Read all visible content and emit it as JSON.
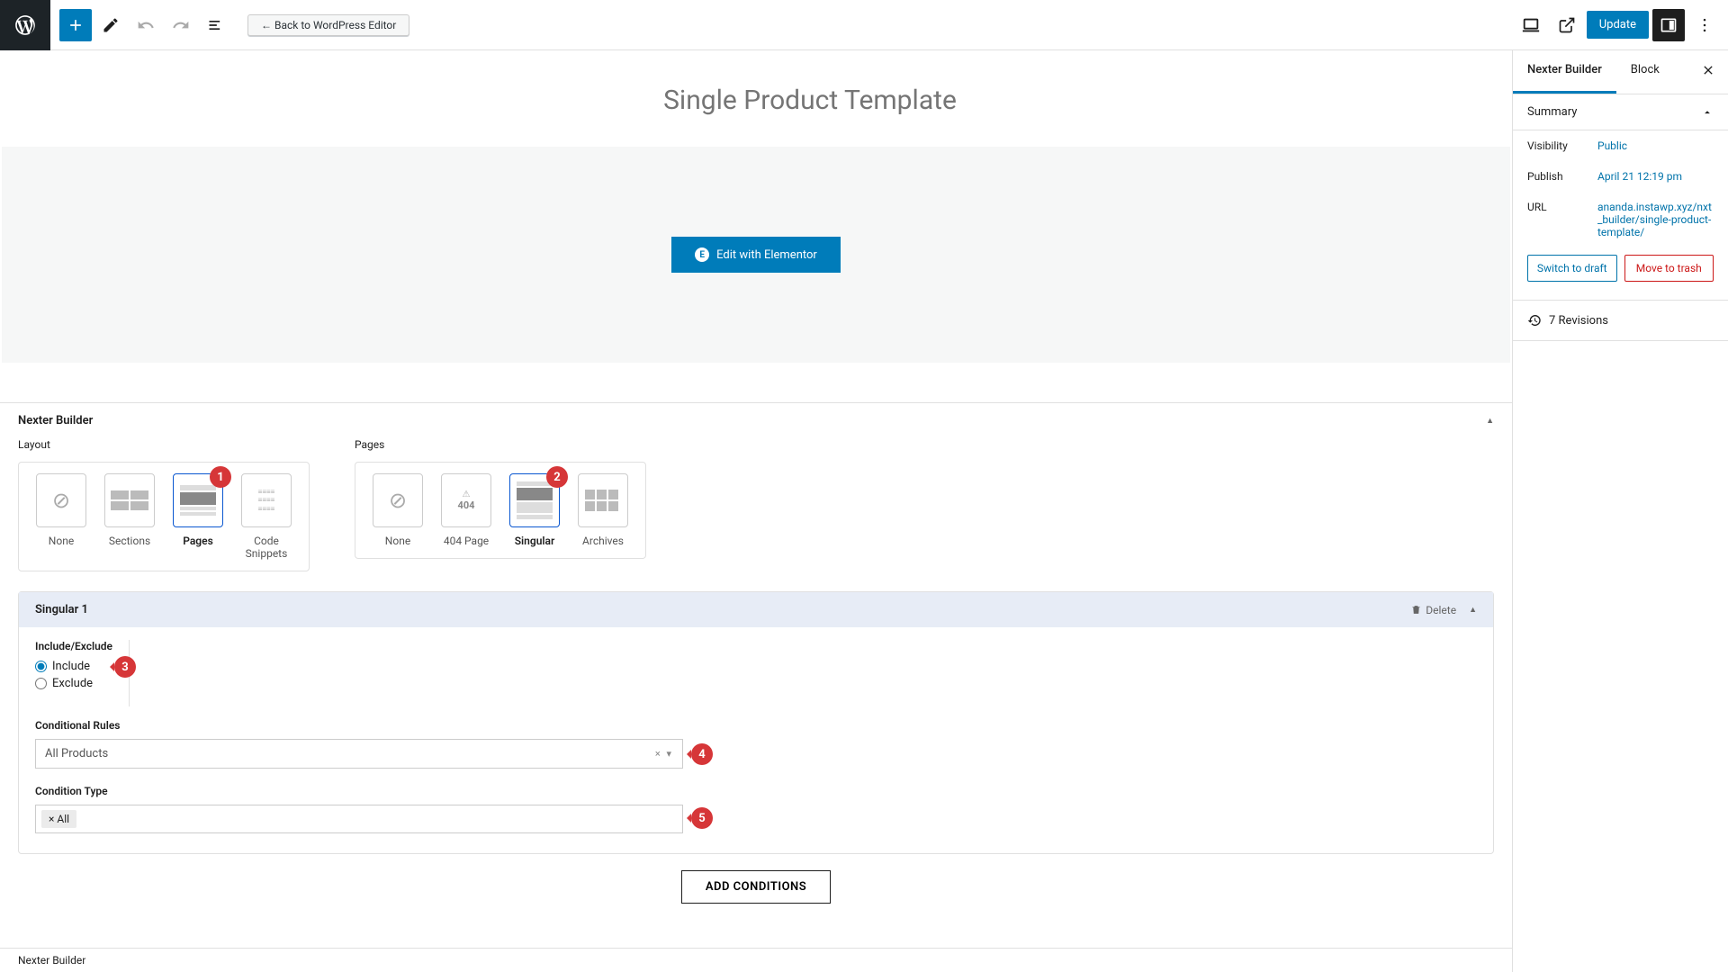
{
  "toolbar": {
    "back_label": "← Back to WordPress Editor",
    "update_label": "Update"
  },
  "page": {
    "title": "Single Product Template",
    "elementor_btn": "Edit with Elementor"
  },
  "nexter": {
    "header": "Nexter Builder",
    "layout_label": "Layout",
    "pages_label": "Pages",
    "layout_cards": [
      {
        "label": "None"
      },
      {
        "label": "Sections"
      },
      {
        "label": "Pages"
      },
      {
        "label": "Code Snippets"
      }
    ],
    "pages_cards": [
      {
        "label": "None"
      },
      {
        "label": "404 Page"
      },
      {
        "label": "Singular"
      },
      {
        "label": "Archives"
      }
    ],
    "singular": {
      "title": "Singular 1",
      "delete": "Delete",
      "ie_label": "Include/Exclude",
      "include": "Include",
      "exclude": "Exclude",
      "cond_rules": "Conditional Rules",
      "cond_value": "All Products",
      "cond_type": "Condition Type",
      "type_value": "× All",
      "add_btn": "ADD CONDITIONS"
    },
    "footer": "Nexter Builder"
  },
  "sidebar": {
    "tab1": "Nexter Builder",
    "tab2": "Block",
    "summary": "Summary",
    "visibility_k": "Visibility",
    "visibility_v": "Public",
    "publish_k": "Publish",
    "publish_v": "April 21 12:19 pm",
    "url_k": "URL",
    "url_v": "ananda.instawp.xyz/nxt_builder/single-product-template/",
    "draft_btn": "Switch to draft",
    "trash_btn": "Move to trash",
    "revisions": "7 Revisions"
  },
  "badges": {
    "b1": "1",
    "b2": "2",
    "b3": "3",
    "b4": "4",
    "b5": "5"
  }
}
